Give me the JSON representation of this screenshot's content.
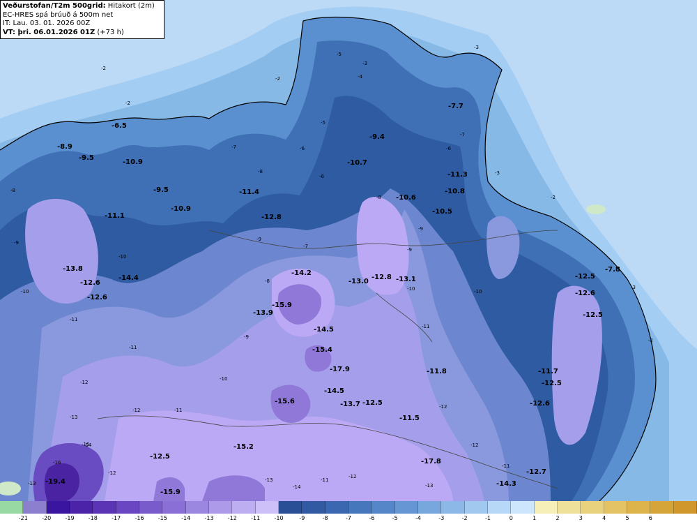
{
  "info": {
    "title_bold": "Veðurstofan/T2m 500grid:",
    "title_rest": "Hitakort (2m)",
    "model": "EC-HRES spá brúuð á 500m net",
    "it": "IT: Lau. 03. 01. 2026 00Z",
    "vt_bold": "VT: þri. 06.01.2026 01Z",
    "vt_rest": "(+73 h)"
  },
  "colors": {
    "ocean": "#bcd9f5",
    "t_minus2": "#a3cdf2",
    "t_minus3": "#86b9e6",
    "t_minus5": "#5a90cf",
    "t_minus7": "#3f6fb5",
    "t_minus9": "#2e5ba2",
    "t_minus10": "#6c87cf",
    "t_minus11": "#8a99de",
    "t_minus12": "#a59eea",
    "t_minus13": "#bca9f5",
    "t_minus15": "#9078d8",
    "t_minus17": "#6a4cc2",
    "t_minus19": "#4a23a3",
    "coast": "#000000",
    "roads": "#444444"
  },
  "colorbar": [
    {
      "label": "",
      "color": "#97d8a3"
    },
    {
      "label": "-21",
      "color": "#8b7fce"
    },
    {
      "label": "-20",
      "color": "#3a16a0"
    },
    {
      "label": "-19",
      "color": "#4a23a8"
    },
    {
      "label": "-18",
      "color": "#5b33b5"
    },
    {
      "label": "-17",
      "color": "#6a46c2"
    },
    {
      "label": "-16",
      "color": "#7a5bcc"
    },
    {
      "label": "-15",
      "color": "#8a70d6"
    },
    {
      "label": "-14",
      "color": "#9b86e0"
    },
    {
      "label": "-13",
      "color": "#ad9ae9"
    },
    {
      "label": "-12",
      "color": "#bdaef2"
    },
    {
      "label": "-11",
      "color": "#cdc0f8"
    },
    {
      "label": "-10",
      "color": "#2a4f96"
    },
    {
      "label": "-9",
      "color": "#315aa3"
    },
    {
      "label": "-8",
      "color": "#3a67b0"
    },
    {
      "label": "-7",
      "color": "#4676bc"
    },
    {
      "label": "-6",
      "color": "#5586c8"
    },
    {
      "label": "-5",
      "color": "#6696d3"
    },
    {
      "label": "-4",
      "color": "#78a7dd"
    },
    {
      "label": "-3",
      "color": "#8cb8e7"
    },
    {
      "label": "-2",
      "color": "#a1c9ef"
    },
    {
      "label": "-1",
      "color": "#b7d8f6"
    },
    {
      "label": "0",
      "color": "#cde6fb"
    },
    {
      "label": "1",
      "color": "#f6efb8"
    },
    {
      "label": "2",
      "color": "#f0e19a"
    },
    {
      "label": "3",
      "color": "#e9d27d"
    },
    {
      "label": "4",
      "color": "#e3c363"
    },
    {
      "label": "5",
      "color": "#ddb44c"
    },
    {
      "label": "6",
      "color": "#d6a53a"
    },
    {
      "label": "",
      "color": "#cf972c"
    }
  ],
  "temps": [
    "-6.5",
    "-8.9",
    "-9.5",
    "-10.9",
    "-9.5",
    "-10.9",
    "-11.1",
    "-11.4",
    "-12.8",
    "-9.4",
    "-10.7",
    "-10.6",
    "-11.3",
    "-10.8",
    "-10.5",
    "-7.7",
    "-13.8",
    "-12.6",
    "-14.4",
    "-12.6",
    "-14.2",
    "-15.9",
    "-13.9",
    "-13.0",
    "-12.8",
    "-13.1",
    "-14.5",
    "-15.4",
    "-17.9",
    "-14.5",
    "-15.6",
    "-13.7",
    "-12.5",
    "-11.8",
    "-11.5",
    "-15.2",
    "-12.5",
    "-17.8",
    "-19.4",
    "-15.9",
    "-14.3",
    "-12.7",
    "-7.8",
    "-12.5",
    "-12.6",
    "-12.5",
    "-11.7",
    "-12.5",
    "-12.6"
  ],
  "contours": [
    "-2",
    "-2",
    "-2",
    "-3",
    "-3",
    "-2",
    "-3",
    "-2",
    "-5",
    "-6",
    "-7",
    "-8",
    "-9",
    "-10",
    "-11",
    "-12",
    "-8",
    "-9",
    "-10",
    "-11",
    "-12",
    "-13",
    "-14",
    "-15",
    "-16",
    "-13",
    "-12",
    "-11",
    "-10",
    "-9",
    "-8",
    "-7",
    "-6",
    "-5",
    "-4",
    "-3",
    "-8",
    "-9",
    "-10",
    "-11",
    "-12",
    "-6",
    "-7",
    "-9",
    "-10",
    "-12",
    "-11",
    "-13",
    "-14",
    "-11",
    "-12",
    "-13"
  ]
}
